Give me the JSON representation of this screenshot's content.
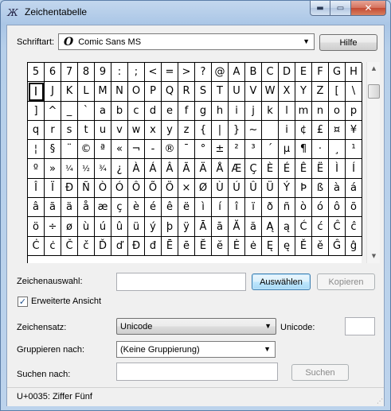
{
  "window": {
    "title": "Zeichentabelle",
    "minimize_glyph": "▬",
    "maximize_glyph": "▭",
    "close_glyph": "✕"
  },
  "font_row": {
    "label": "Schriftart:",
    "font_logo": "O",
    "selected_font": "Comic Sans MS",
    "help_button": "Hilfe"
  },
  "characters": [
    [
      "5",
      "6",
      "7",
      "8",
      "9",
      ":",
      ";",
      "<",
      "=",
      ">",
      "?",
      "@",
      "A",
      "B",
      "C",
      "D",
      "E",
      "F",
      "G",
      "H"
    ],
    [
      "I",
      "J",
      "K",
      "L",
      "M",
      "N",
      "O",
      "P",
      "Q",
      "R",
      "S",
      "T",
      "U",
      "V",
      "W",
      "X",
      "Y",
      "Z",
      "[",
      "\\"
    ],
    [
      "]",
      "^",
      "_",
      "`",
      "a",
      "b",
      "c",
      "d",
      "e",
      "f",
      "g",
      "h",
      "i",
      "j",
      "k",
      "l",
      "m",
      "n",
      "o",
      "p"
    ],
    [
      "q",
      "r",
      "s",
      "t",
      "u",
      "v",
      "w",
      "x",
      "y",
      "z",
      "{",
      "|",
      "}",
      "~",
      " ",
      "i",
      "¢",
      "£",
      "¤",
      "¥"
    ],
    [
      "¦",
      "§",
      "¨",
      "©",
      "ª",
      "«",
      "¬",
      "-",
      "®",
      "¯",
      "°",
      "±",
      "²",
      "³",
      "´",
      "µ",
      "¶",
      "·",
      "¸",
      "¹"
    ],
    [
      "º",
      "»",
      "¼",
      "½",
      "¾",
      "¿",
      "À",
      "Á",
      "Â",
      "Ã",
      "Ä",
      "Å",
      "Æ",
      "Ç",
      "È",
      "É",
      "Ê",
      "Ë",
      "Ì",
      "Í"
    ],
    [
      "Î",
      "Ï",
      "Ð",
      "Ñ",
      "Ò",
      "Ó",
      "Ô",
      "Õ",
      "Ö",
      "×",
      "Ø",
      "Ù",
      "Ú",
      "Û",
      "Ü",
      "Ý",
      "Þ",
      "ß",
      "à",
      "á"
    ],
    [
      "â",
      "ã",
      "ä",
      "å",
      "æ",
      "ç",
      "è",
      "é",
      "ê",
      "ë",
      "ì",
      "í",
      "î",
      "ï",
      "ð",
      "ñ",
      "ò",
      "ó",
      "ô",
      "õ"
    ],
    [
      "ö",
      "÷",
      "ø",
      "ù",
      "ú",
      "û",
      "ü",
      "ý",
      "þ",
      "ÿ",
      "Ā",
      "ā",
      "Ă",
      "ă",
      "Ą",
      "ą",
      "Ć",
      "ć",
      "Ĉ",
      "ĉ"
    ],
    [
      "Ċ",
      "ċ",
      "Č",
      "č",
      "Ď",
      "ď",
      "Đ",
      "đ",
      "Ē",
      "ē",
      "Ĕ",
      "ĕ",
      "Ė",
      "ė",
      "Ę",
      "ę",
      "Ě",
      "ě",
      "Ĝ",
      "ĝ"
    ]
  ],
  "selected_character": "I",
  "selection": {
    "label": "Zeichenauswahl:",
    "value": "",
    "select_button": "Auswählen",
    "copy_button": "Kopieren"
  },
  "advanced_view": {
    "label": "Erweiterte Ansicht",
    "checked": true,
    "check_glyph": "✓"
  },
  "charset": {
    "label": "Zeichensatz:",
    "value": "Unicode"
  },
  "unicode": {
    "label": "Unicode:",
    "value": ""
  },
  "group_by": {
    "label": "Gruppieren nach:",
    "value": "(Keine Gruppierung)"
  },
  "search": {
    "label": "Suchen nach:",
    "value": "",
    "button": "Suchen"
  },
  "status": {
    "text": "U+0035: Ziffer Fünf"
  },
  "icons": {
    "dropdown": "▼",
    "scroll_up": "▲",
    "scroll_down": "▼",
    "grip": "⋰"
  }
}
